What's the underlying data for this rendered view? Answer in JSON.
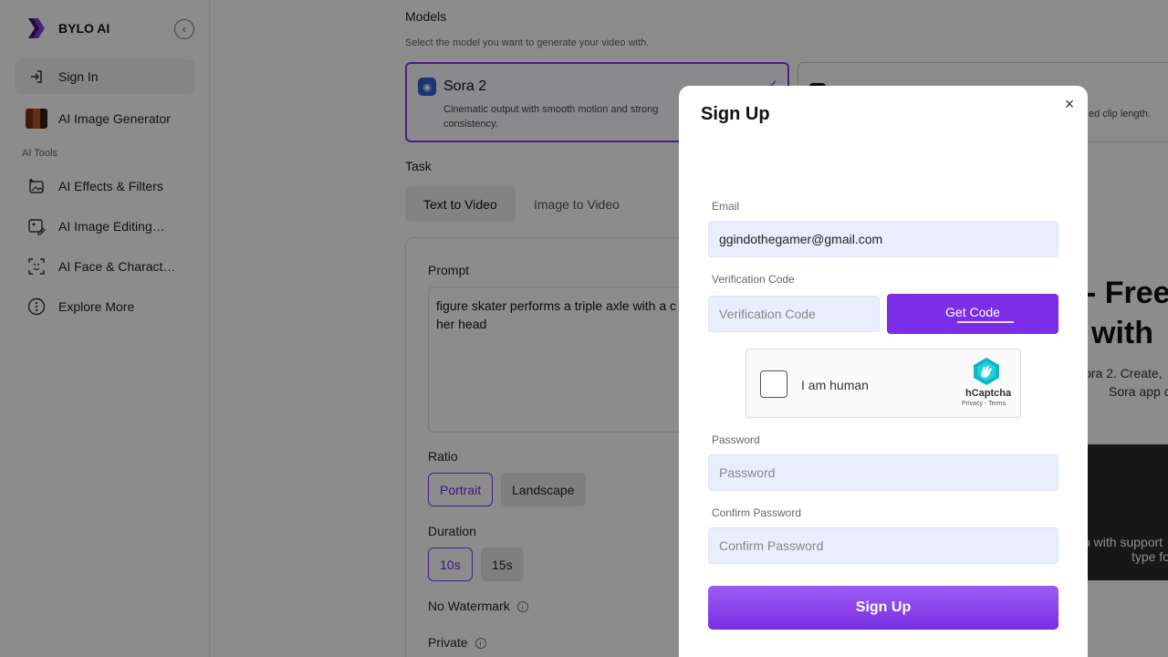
{
  "sidebar": {
    "brand": "BYLO AI",
    "sign_in": "Sign In",
    "image_generator": "AI Image Generator",
    "section_label": "AI Tools",
    "tools": [
      {
        "label": "AI Effects & Filters",
        "icon": "sparkle-image-icon"
      },
      {
        "label": "AI Image Editing…",
        "icon": "image-edit-icon"
      },
      {
        "label": "AI Face & Charact…",
        "icon": "face-scan-icon"
      },
      {
        "label": "Explore More",
        "icon": "more-dots-icon"
      }
    ]
  },
  "main": {
    "models_title": "Models",
    "models_subtitle": "Select the model you want to generate your video with.",
    "models": [
      {
        "name": "Sora 2",
        "desc": "Cinematic output with smooth motion and strong consistency.",
        "selected": true
      },
      {
        "name": "",
        "desc": "ed clip length.",
        "selected": false
      }
    ],
    "task_title": "Task",
    "tabs": [
      "Text to Video",
      "Image to Video"
    ],
    "prompt_label": "Prompt",
    "prompt_value": "figure skater performs a triple axle with a c\nher head",
    "ratio_label": "Ratio",
    "ratio_options": [
      "Portrait",
      "Landscape"
    ],
    "duration_label": "Duration",
    "duration_options": [
      "10s",
      "15s"
    ],
    "no_watermark_label": "No Watermark",
    "private_label": "Private"
  },
  "promo": {
    "head1": "- Free",
    "head2": "with",
    "text1": "ora 2. Create,",
    "text2": "Sora app c",
    "img_text1": "o with support",
    "img_text2": "type fo"
  },
  "modal": {
    "title": "Sign Up",
    "email_label": "Email",
    "email_value": "ggindothegamer@gmail.com",
    "code_label": "Verification Code",
    "code_placeholder": "Verification Code",
    "get_code": "Get Code",
    "captcha_text": "I am human",
    "captcha_brand": "hCaptcha",
    "captcha_links": "Privacy - Terms",
    "password_label": "Password",
    "password_placeholder": "Password",
    "confirm_label": "Confirm Password",
    "confirm_placeholder": "Confirm Password",
    "submit": "Sign Up"
  },
  "colors": {
    "accent": "#7c2ee6",
    "input_bg": "#e8eefc",
    "overlay": "rgba(0,0,0,0.45)"
  }
}
